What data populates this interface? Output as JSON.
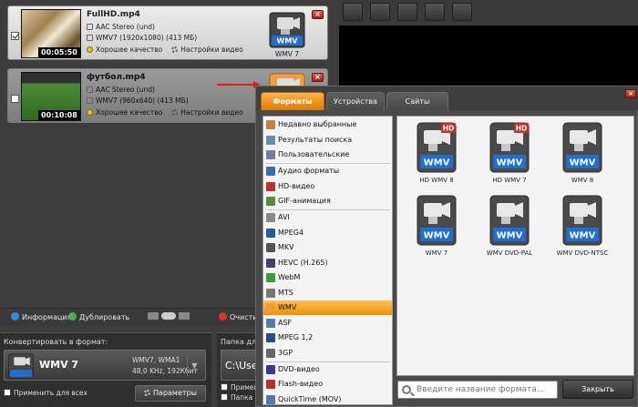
{
  "files": [
    {
      "name": "FullHD.mp4",
      "duration": "00:05:50",
      "audio": "AAC Stereo (und)",
      "video": "WMV7 (1920x1080) (413 МБ)",
      "quality": "Хорошее качество",
      "settings": "Настройки видео",
      "format_badge": "WMV",
      "format_label": "WMV 7",
      "checked": true
    },
    {
      "name": "футбол.mp4",
      "duration": "00:10:08",
      "audio": "AAC Stereo (und)",
      "video": "WMV7 (960x640) (413 МБ)",
      "quality": "Хорошее качество",
      "settings": "Настройки видео",
      "format_badge": "WMV",
      "checked": false
    }
  ],
  "left_toolbar": {
    "info": "Информация",
    "duplicate": "Дублировать",
    "clear": "Очистить"
  },
  "convert": {
    "title": "Конвертировать в формат:",
    "format": "WMV 7",
    "spec_line1": "WMV7, WMA1",
    "spec_line2": "48,0 KHz, 192Кбит",
    "apply_all": "Применить для всех",
    "params_button": "Параметры"
  },
  "folder": {
    "title": "Папка для",
    "path": "C:\\Use",
    "opt1": "Примени",
    "opt2": "Папка с"
  },
  "dialog": {
    "tabs": [
      "Форматы",
      "Устройства",
      "Сайты"
    ],
    "active_tab": 0,
    "categories": [
      {
        "label": "Недавно выбранные",
        "icon": "recent-icon"
      },
      {
        "label": "Результаты поиска",
        "icon": "search-results-icon"
      },
      {
        "label": "Пользовательские",
        "icon": "user-icon"
      },
      {
        "label": "Аудио форматы",
        "icon": "music-note-icon"
      },
      {
        "label": "HD-видео",
        "icon": "hd-icon"
      },
      {
        "label": "GIF-анимация",
        "icon": "gif-icon"
      },
      {
        "label": "AVI",
        "icon": "film-reel-icon"
      },
      {
        "label": "MPEG4",
        "icon": "mpeg4-icon"
      },
      {
        "label": "MKV",
        "icon": "mkv-icon"
      },
      {
        "label": "HEVC (H.265)",
        "icon": "hevc-icon"
      },
      {
        "label": "WebM",
        "icon": "webm-icon"
      },
      {
        "label": "MTS",
        "icon": "mts-icon"
      },
      {
        "label": "WMV",
        "icon": "wmv-icon"
      },
      {
        "label": "ASF",
        "icon": "asf-icon"
      },
      {
        "label": "MPEG 1,2",
        "icon": "mpeg12-icon"
      },
      {
        "label": "3GP",
        "icon": "phone-icon"
      },
      {
        "label": "DVD-видео",
        "icon": "dvd-icon"
      },
      {
        "label": "Flash-видео",
        "icon": "flash-icon"
      },
      {
        "label": "QuickTime (MOV)",
        "icon": "quicktime-icon"
      }
    ],
    "selected_category": "WMV",
    "formats": [
      {
        "label": "HD WMV 8",
        "badge": "WMV",
        "hd": true
      },
      {
        "label": "HD WMV 7",
        "badge": "WMV",
        "hd": true
      },
      {
        "label": "WMV 8",
        "badge": "WMV",
        "hd": false
      },
      {
        "label": "WMV 7",
        "badge": "WMV",
        "hd": false
      },
      {
        "label": "WMV DVD-PAL",
        "badge": "WMV",
        "hd": false
      },
      {
        "label": "WMV DVD-NTSC",
        "badge": "WMV",
        "hd": false
      }
    ],
    "hd_badge": "HD",
    "search_placeholder": "Введите название формата...",
    "close_button": "Закрыть",
    "close_x": "×"
  },
  "colors": {
    "accent": "#f39a1a",
    "wmv_blue": "#1e6fd0",
    "hd_red": "#c0302a"
  }
}
